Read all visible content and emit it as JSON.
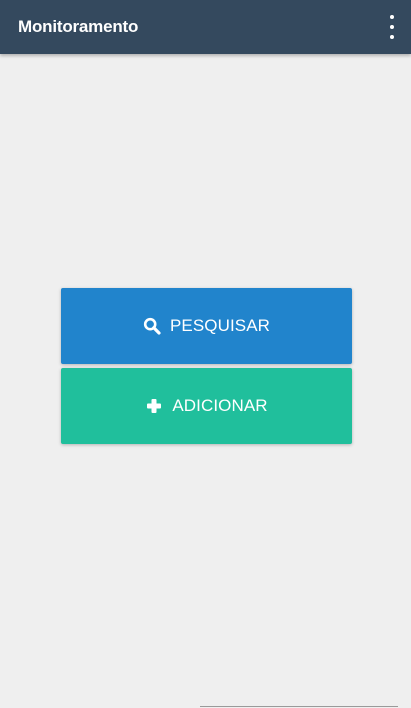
{
  "appbar": {
    "title": "Monitoramento",
    "menu_icon": "more-vert-icon"
  },
  "actions": {
    "search": {
      "label": "PESQUISAR",
      "icon": "search-icon",
      "color": "#2184cc"
    },
    "add": {
      "label": "ADICIONAR",
      "icon": "plus-icon",
      "color": "#20bf9c"
    }
  },
  "colors": {
    "appbar_background": "#34495e",
    "page_background": "#efefef",
    "text_on_color": "#ffffff"
  }
}
